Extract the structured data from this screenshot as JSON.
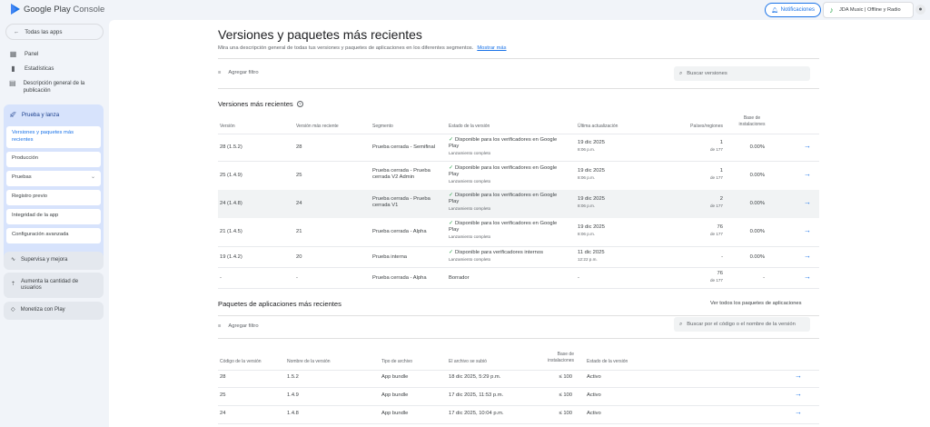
{
  "header": {
    "logo_text": "Google Play",
    "logo_text_suffix": "Console",
    "notifications_label": "Notificaciones",
    "app_name": "JDA Music | Offline y Radio"
  },
  "sidebar": {
    "all_apps": "Todas las apps",
    "items": [
      {
        "icon": "dashboard-icon",
        "label": "Panel"
      },
      {
        "icon": "bar-chart-icon",
        "label": "Estadísticas"
      },
      {
        "icon": "store-listing-icon",
        "label": "Descripción general de la publicación"
      }
    ],
    "group": {
      "label": "Prueba y lanza",
      "sub_items": [
        {
          "label": "Versiones y paquetes más recientes",
          "active": true
        },
        {
          "label": "Producción"
        },
        {
          "label": "Pruebas"
        },
        {
          "label": "Registro previo"
        },
        {
          "label": "Integridad de la app"
        },
        {
          "label": "Configuración avanzada"
        }
      ]
    },
    "cards": [
      {
        "icon": "monitor-icon",
        "label": "Supervisa y mejora"
      },
      {
        "icon": "grow-users-icon",
        "label": "Aumenta la cantidad de usuarios"
      },
      {
        "icon": "tag-icon",
        "label": "Monetiza con Play"
      }
    ]
  },
  "main": {
    "title": "Versiones y paquetes más recientes",
    "description": "Mira una descripción general de todas tus versiones y paquetes de aplicaciones en los diferentes segmentos.",
    "show_more": "Mostrar más",
    "filter_label": "Agregar filtro",
    "search_versions_placeholder": "Buscar versiones",
    "releases_title": "Versiones más recientes",
    "releases_headers": [
      "Versión",
      "Versión más reciente",
      "Segmento",
      "Estado de la versión",
      "Última actualización",
      "Países/regiones",
      "Base de instalaciones"
    ],
    "releases_rows": [
      {
        "version": "28 (1.5.2)",
        "latest": "28",
        "segment": "Prueba cerrada - Semifinal",
        "status": "Disponible para los verificadores en Google Play",
        "status_sub": "Lanzamiento completo",
        "status_ok": true,
        "date": "19 dic 2025",
        "time": "8:06 p.m.",
        "countries": "1",
        "countries_sub": "de 177",
        "install_base": "0.00%",
        "arrow": true
      },
      {
        "version": "25 (1.4.9)",
        "latest": "25",
        "segment": "Prueba cerrada - Prueba cerrada V2 Admin",
        "status": "Disponible para los verificadores en Google Play",
        "status_sub": "Lanzamiento completo",
        "status_ok": true,
        "date": "19 dic 2025",
        "time": "8:06 p.m.",
        "countries": "1",
        "countries_sub": "de 177",
        "install_base": "0.00%",
        "arrow": true
      },
      {
        "version": "24 (1.4.8)",
        "latest": "24",
        "segment": "Prueba cerrada - Prueba cerrada V1",
        "status": "Disponible para los verificadores en Google Play",
        "status_sub": "Lanzamiento completo",
        "status_ok": true,
        "date": "19 dic 2025",
        "time": "8:06 p.m.",
        "countries": "2",
        "countries_sub": "de 177",
        "install_base": "0.00%",
        "arrow": true
      },
      {
        "version": "21 (1.4.5)",
        "latest": "21",
        "segment": "Prueba cerrada - Alpha",
        "status": "Disponible para los verificadores en Google Play",
        "status_sub": "Lanzamiento completo",
        "status_ok": true,
        "date": "19 dic 2025",
        "time": "8:06 p.m.",
        "countries": "76",
        "countries_sub": "de 177",
        "install_base": "0.00%",
        "arrow": true
      },
      {
        "version": "19 (1.4.2)",
        "latest": "20",
        "segment": "Prueba interna",
        "status": "Disponible para verificadores internos",
        "status_sub": "Lanzamiento completo",
        "status_ok": true,
        "date": "11 dic 2025",
        "time": "12:22 p.m.",
        "countries": "-",
        "countries_sub": "",
        "install_base": "0.00%",
        "arrow": true
      },
      {
        "version": "-",
        "latest": "-",
        "segment": "Prueba cerrada - Alpha",
        "status": "Borrador",
        "status_sub": "",
        "status_ok": false,
        "date": "-",
        "time": "",
        "countries": "76",
        "countries_sub": "de 177",
        "install_base": "-",
        "arrow": true
      }
    ],
    "bundles_title": "Paquetes de aplicaciones más recientes",
    "view_all_bundles": "Ver todos los paquetes de aplicaciones",
    "search_bundles_placeholder": "Buscar por el código o el nombre de la versión",
    "bundles_headers": [
      "Código de la versión",
      "Nombre de la versión",
      "Tipo de archivo",
      "El archivo se subió",
      "Base de instalaciones",
      "Estado de la versión"
    ],
    "bundles_rows": [
      {
        "code": "28",
        "name": "1.5.2",
        "type": "App bundle",
        "uploaded": "18 dic 2025, 5:29 p.m.",
        "installs": "≤ 100",
        "status": "Activo"
      },
      {
        "code": "25",
        "name": "1.4.9",
        "type": "App bundle",
        "uploaded": "17 dic 2025, 11:53 p.m.",
        "installs": "≤ 100",
        "status": "Activo"
      },
      {
        "code": "24",
        "name": "1.4.8",
        "type": "App bundle",
        "uploaded": "17 dic 2025, 10:04 p.m.",
        "installs": "≤ 100",
        "status": "Activo"
      }
    ]
  }
}
